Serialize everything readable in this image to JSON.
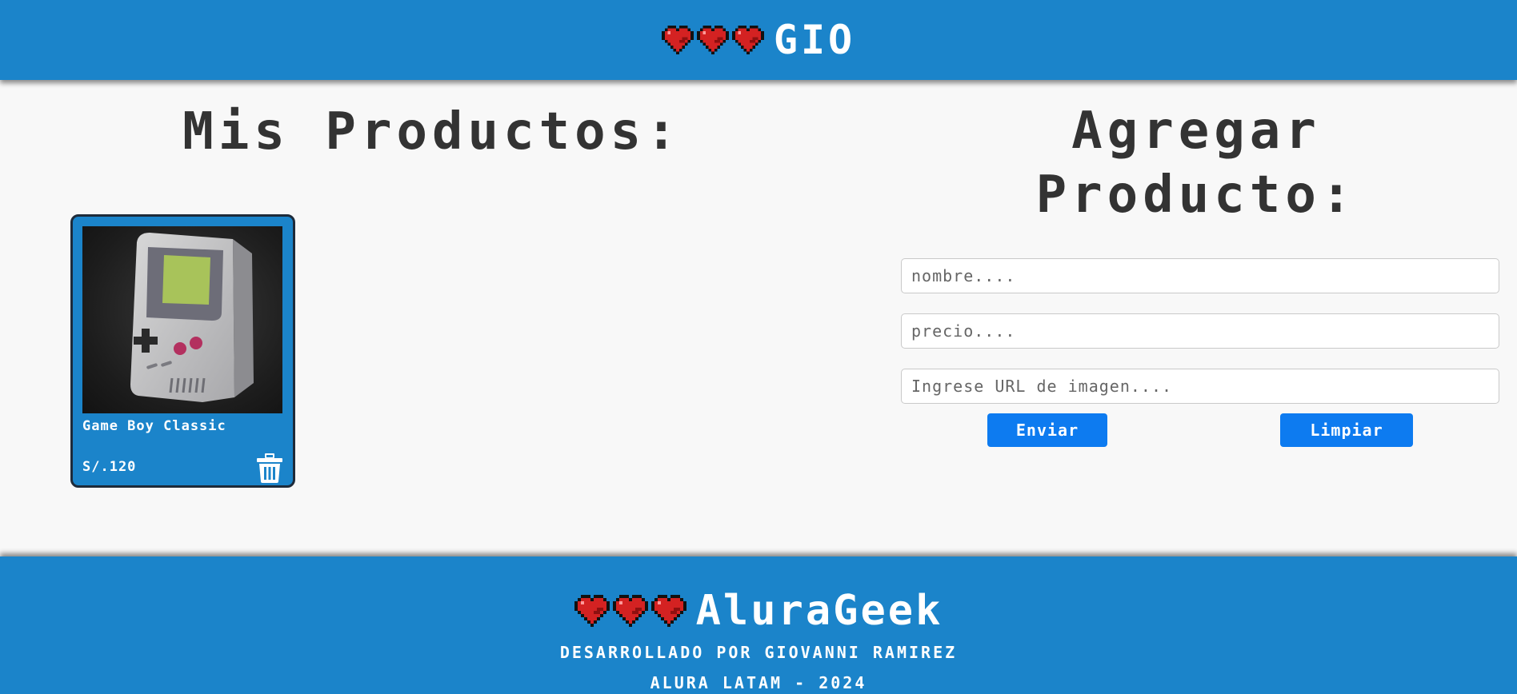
{
  "header": {
    "brand": "GIO",
    "hearts_count": 3,
    "heart_icon": "pixel-heart-icon"
  },
  "products": {
    "title": "Mis Productos:",
    "items": [
      {
        "name": "Game Boy Classic",
        "price": "S/.120",
        "image_alt": "Game Boy Classic",
        "delete_icon": "trash-icon"
      }
    ]
  },
  "form": {
    "title_line1": "Agregar",
    "title_line2": "Producto:",
    "name_placeholder": "nombre....",
    "price_placeholder": "precio....",
    "image_placeholder": "Ingrese URL de imagen....",
    "submit_label": "Enviar",
    "clear_label": "Limpiar"
  },
  "footer": {
    "brand": "AluraGeek",
    "credit": "DESARROLLADO POR GIOVANNI RAMIREZ",
    "org": "ALURA LATAM - 2024"
  },
  "colors": {
    "header_bg": "#1b84ca",
    "card_bg": "#1b84ca",
    "button_bg": "#0d7bf0",
    "heart": "#d42222"
  }
}
